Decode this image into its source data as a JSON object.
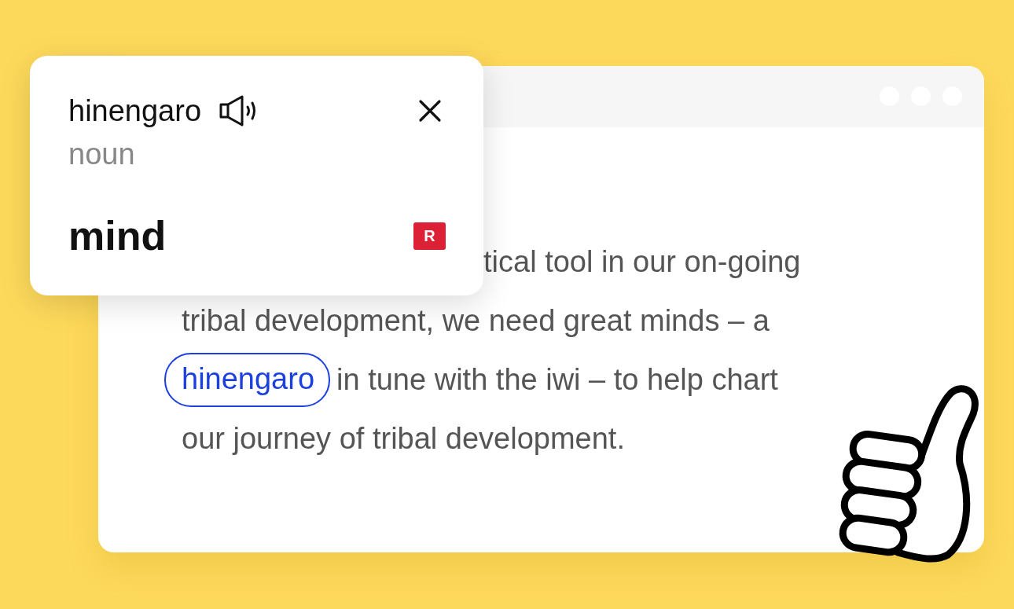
{
  "popup": {
    "headword": "hinengaro",
    "part_of_speech": "noun",
    "translation": "mind",
    "badge": "R"
  },
  "paragraph": {
    "lines": [
      {
        "partial": true,
        "segments": [
          {
            "text": "tical tool in our on-going",
            "highlighted": false
          }
        ]
      },
      {
        "partial": false,
        "segments": [
          {
            "text": "tribal development, we need great minds – a",
            "highlighted": false
          }
        ]
      },
      {
        "partial": false,
        "segments": [
          {
            "text": "hinengaro",
            "highlighted": true
          },
          {
            "text": "in tune with the iwi – to help chart",
            "highlighted": false
          }
        ]
      },
      {
        "partial": false,
        "segments": [
          {
            "text": "our journey of tribal development.",
            "highlighted": false
          }
        ]
      }
    ]
  }
}
